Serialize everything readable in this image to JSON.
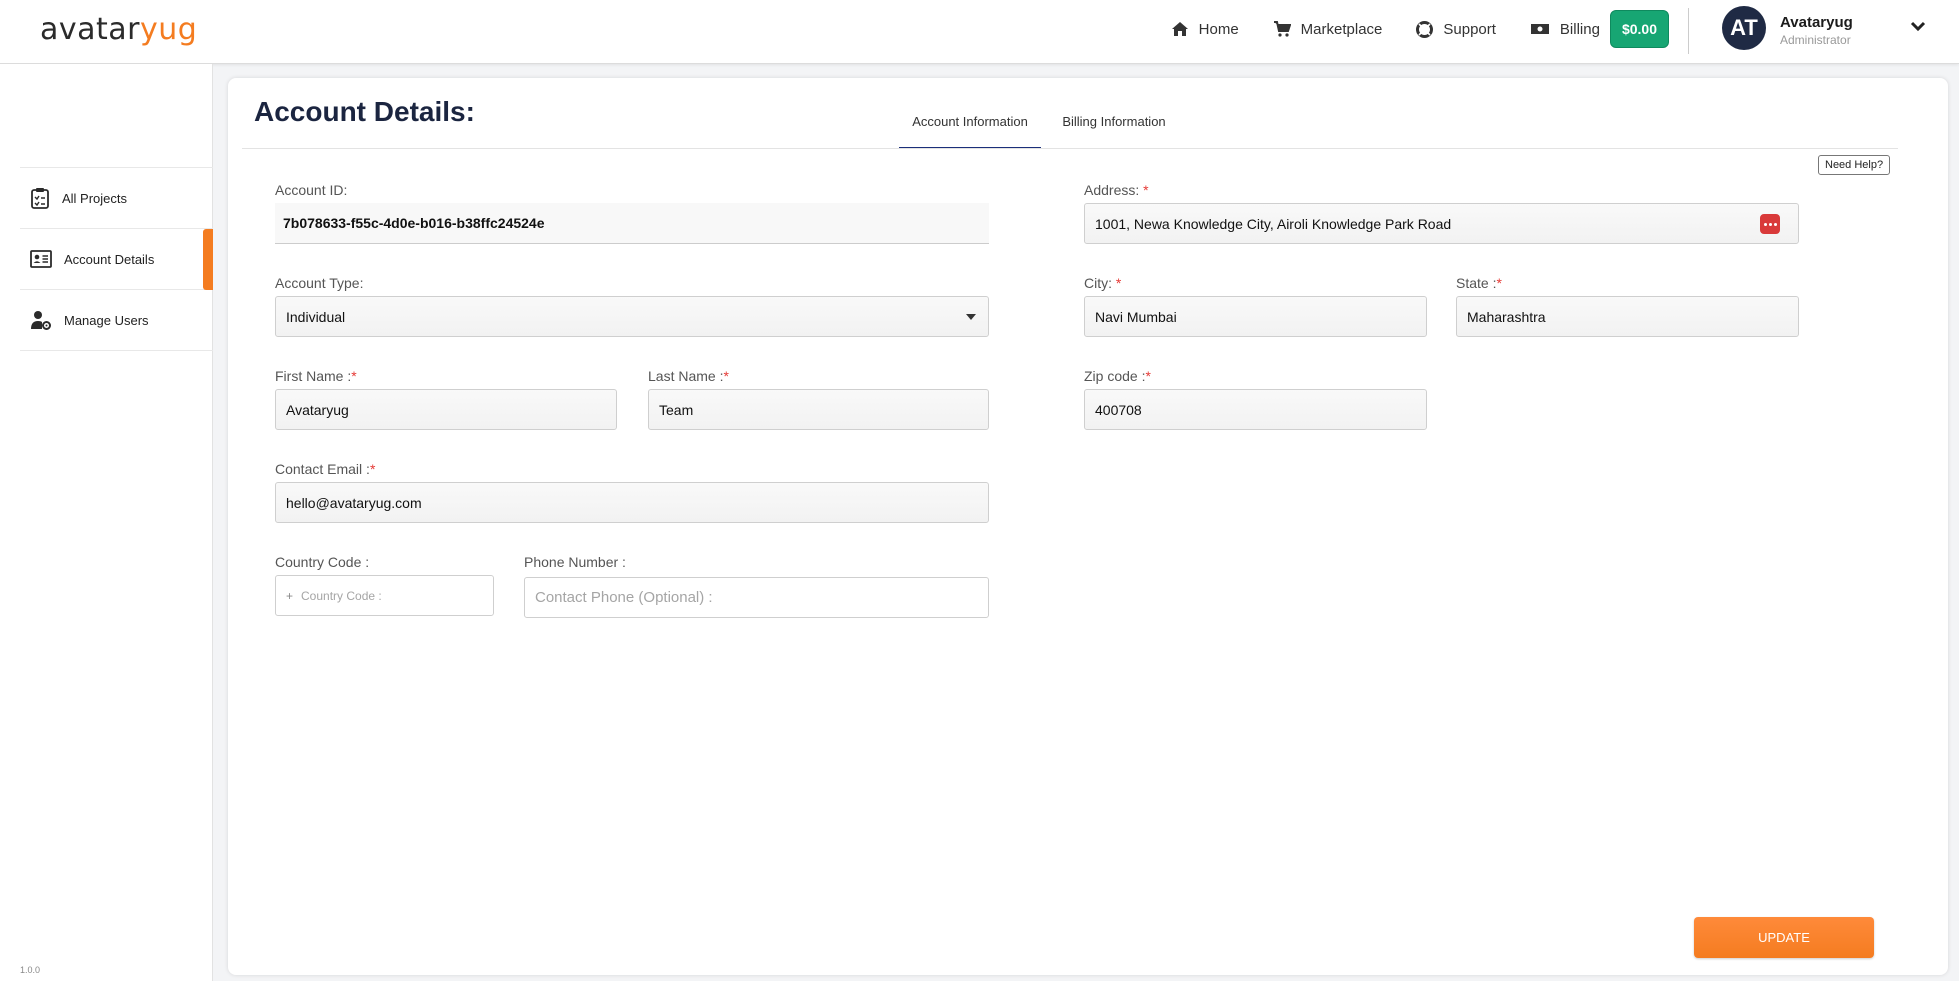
{
  "brand": {
    "logo_dark": "avatar",
    "logo_accent": "yug",
    "accent_color": "#f47c20"
  },
  "nav": {
    "home": "Home",
    "marketplace": "Marketplace",
    "support": "Support",
    "billing": "Billing",
    "balance": "$0.00"
  },
  "user": {
    "initials": "AT",
    "name": "Avataryug",
    "role": "Administrator"
  },
  "sidebar": {
    "items": [
      {
        "label": "All Projects",
        "icon": "clipboard-icon"
      },
      {
        "label": "Account Details",
        "icon": "id-card-icon",
        "active": true
      },
      {
        "label": "Manage Users",
        "icon": "user-gear-icon"
      }
    ],
    "version": "1.0.0"
  },
  "page": {
    "title": "Account Details:",
    "tabs": [
      "Account Information",
      "Billing Information"
    ],
    "active_tab": 0,
    "help": "Need Help?"
  },
  "form": {
    "account_id": {
      "label": "Account ID:",
      "value": "7b078633-f55c-4d0e-b016-b38ffc24524e"
    },
    "account_type": {
      "label": "Account Type:",
      "value": "Individual"
    },
    "first_name": {
      "label": "First Name :",
      "value": "Avataryug"
    },
    "last_name": {
      "label": "Last Name :",
      "value": "Team"
    },
    "contact_email": {
      "label": "Contact Email :",
      "value": "hello@avataryug.com"
    },
    "country_code": {
      "label": "Country Code :",
      "prefix": "+",
      "placeholder": "Country Code :"
    },
    "phone_number": {
      "label": "Phone Number :",
      "placeholder": "Contact Phone (Optional) :"
    },
    "address": {
      "label": "Address:",
      "value": "1001, Newa Knowledge City,  Airoli Knowledge Park Road"
    },
    "city": {
      "label": "City:",
      "value": "Navi Mumbai"
    },
    "state": {
      "label": "State :",
      "value": "Maharashtra"
    },
    "zip": {
      "label": "Zip code :",
      "value": "400708"
    },
    "required_mark": "*",
    "update": "UPDATE"
  }
}
